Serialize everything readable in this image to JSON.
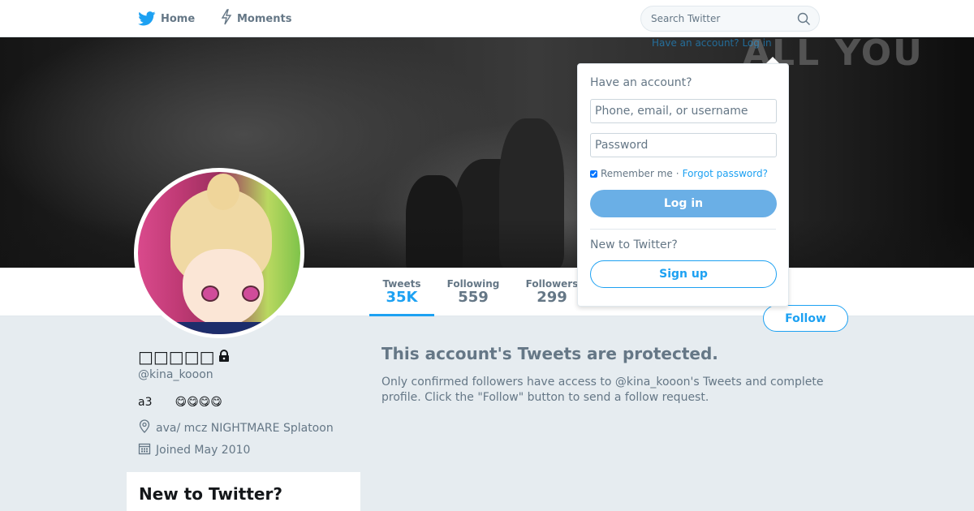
{
  "nav": {
    "home_label": "Home",
    "moments_label": "Moments",
    "search_placeholder": "Search Twitter"
  },
  "banner": {
    "overlay_text": "ALL YOU"
  },
  "profile": {
    "display_name": "□□□□□",
    "handle": "@kina_kooon",
    "bio": "a3　　😋😋😋😋",
    "location": "ava/ mcz NIGHTMARE Splatoon",
    "joined": "Joined May 2010"
  },
  "stats": [
    {
      "label": "Tweets",
      "value": "35K",
      "active": true
    },
    {
      "label": "Following",
      "value": "559",
      "active": false
    },
    {
      "label": "Followers",
      "value": "299",
      "active": false
    }
  ],
  "follow_label": "Follow",
  "protected": {
    "title": "This account's Tweets are protected.",
    "body": "Only confirmed followers have access to @kina_kooon's Tweets and complete profile. Click the \"Follow\" button to send a follow request."
  },
  "signup_card": {
    "title": "New to Twitter?"
  },
  "login": {
    "ghost_link": "Have an account? Log in",
    "title": "Have an account?",
    "username_placeholder": "Phone, email, or username",
    "password_placeholder": "Password",
    "remember_label": "Remember me",
    "separator": "·",
    "forgot_label": "Forgot password?",
    "login_button": "Log in",
    "new_label": "New to Twitter?",
    "signup_button": "Sign up"
  },
  "colors": {
    "accent": "#1da1f2",
    "background": "#e6ecf0",
    "muted_text": "#657786",
    "login_button": "#6aafe6"
  },
  "icons": [
    "bird-icon",
    "lightning-icon",
    "search-icon",
    "lock-icon",
    "location-icon",
    "calendar-icon"
  ]
}
